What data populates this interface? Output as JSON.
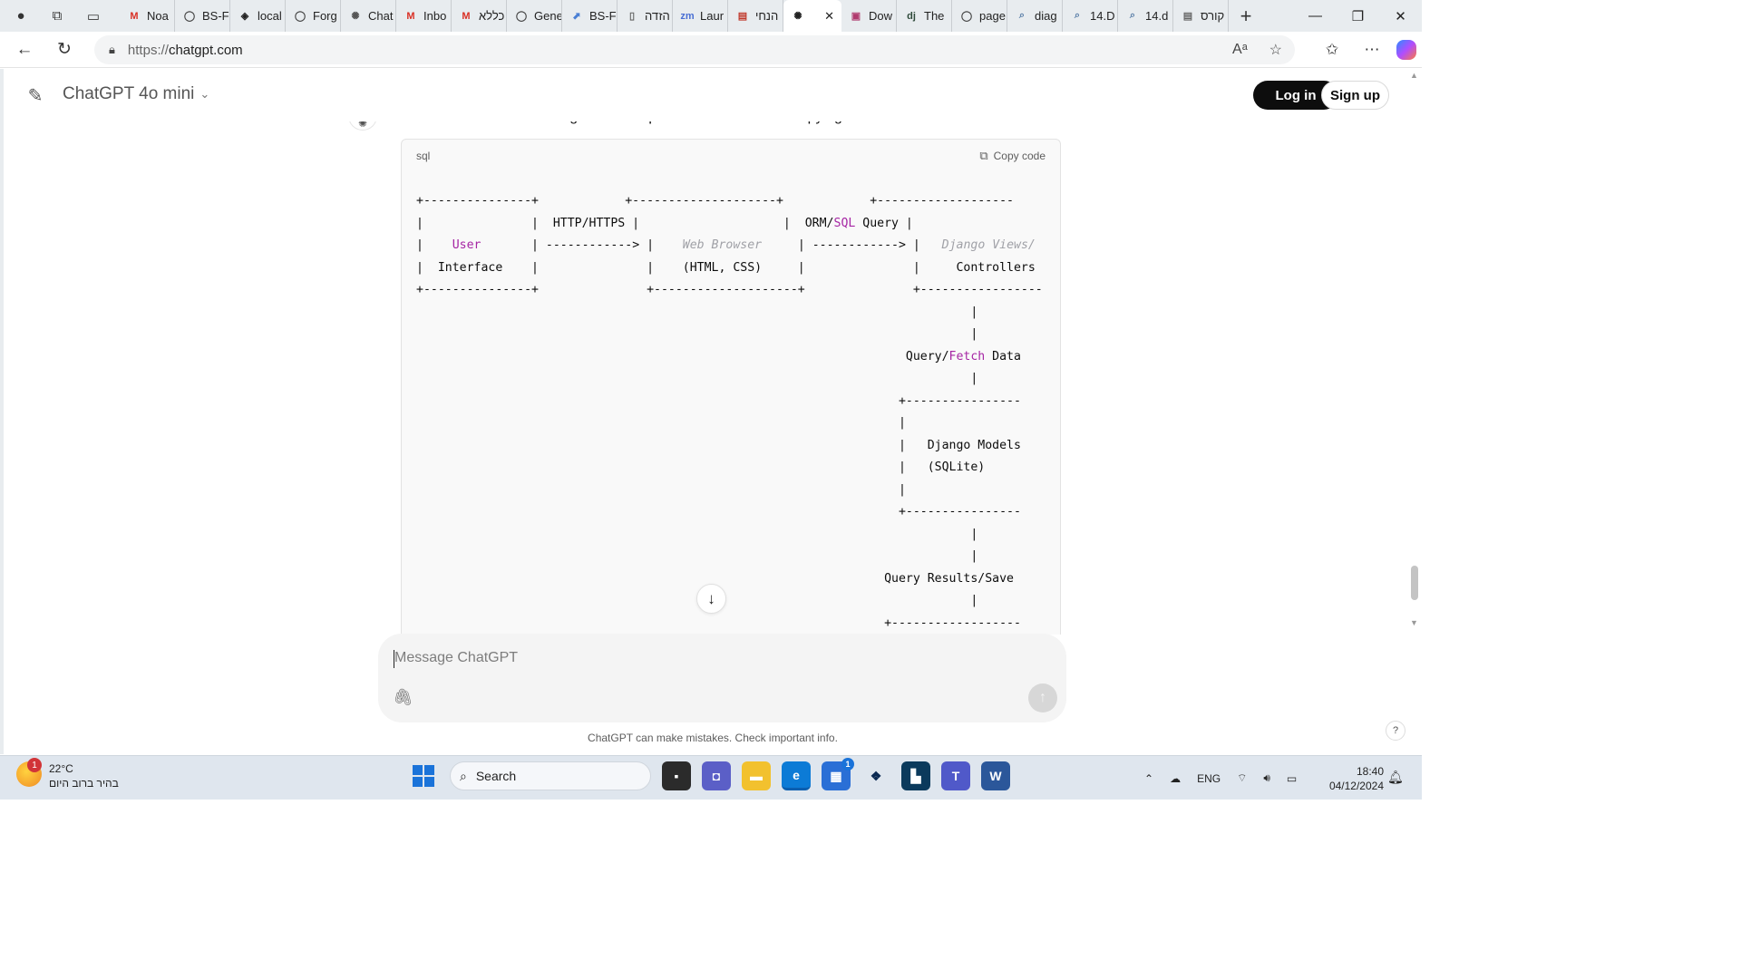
{
  "browser": {
    "tabs": [
      {
        "icon": "M",
        "icon_color": "#d93025",
        "label": "Noa"
      },
      {
        "icon": "◯",
        "icon_color": "#444444",
        "label": "BS-F"
      },
      {
        "icon": "◈",
        "icon_color": "#222222",
        "label": "local"
      },
      {
        "icon": "◯",
        "icon_color": "#444444",
        "label": "Forg"
      },
      {
        "icon": "✺",
        "icon_color": "#555555",
        "label": "Chat"
      },
      {
        "icon": "M",
        "icon_color": "#d93025",
        "label": "Inbo"
      },
      {
        "icon": "M",
        "icon_color": "#d93025",
        "label": "כללא"
      },
      {
        "icon": "◯",
        "icon_color": "#444444",
        "label": "Gene"
      },
      {
        "icon": "⬈",
        "icon_color": "#4a7fd4",
        "label": "BS-F"
      },
      {
        "icon": "▯",
        "icon_color": "#666666",
        "label": "הזדה"
      },
      {
        "icon": "zm",
        "icon_color": "#4a6fd4",
        "label": "Laur"
      },
      {
        "icon": "▤",
        "icon_color": "#c0392b",
        "label": "הנחי"
      }
    ],
    "active_tab": {
      "icon": "✺",
      "close": "✕"
    },
    "tabs_after": [
      {
        "icon": "▣",
        "icon_color": "#b03a6e",
        "label": "Dow"
      },
      {
        "icon": "dj",
        "icon_color": "#2e4a3a",
        "label": "The"
      },
      {
        "icon": "◯",
        "icon_color": "#444444",
        "label": "page"
      },
      {
        "icon": "⌕",
        "icon_color": "#5a7fa8",
        "label": "diag"
      },
      {
        "icon": "⌕",
        "icon_color": "#5a7fa8",
        "label": "14.D"
      },
      {
        "icon": "⌕",
        "icon_color": "#5a7fa8",
        "label": "14.d"
      },
      {
        "icon": "▤",
        "icon_color": "#666666",
        "label": "קורס"
      }
    ],
    "new_tab": "+",
    "url_proto": "https://",
    "url_host": "chatgpt.com",
    "window_controls": [
      "—",
      "❐",
      "✕"
    ]
  },
  "header": {
    "model": "ChatGPT 4o mini",
    "login": "Log in",
    "signup": "Sign up"
  },
  "message": {
    "text": "Here's the architecture diagram with square boxes for easier copying:"
  },
  "code": {
    "language": "sql",
    "copy_label": "Copy code",
    "lines": [
      "+---------------+            +--------------------+            +-------------------",
      "|               |  HTTP/HTTPS |                    |  ORM/SQL Query |",
      "|    User       | ------------> |    Web Browser     | ------------> |   Django Views/",
      "|  Interface    |               |    (HTML, CSS)     |               |     Controllers",
      "+---------------+               +--------------------+               +-----------------",
      "                                                                             |",
      "                                                                             |",
      "                                                                    Query/Fetch Data",
      "                                                                             |",
      "                                                                   +----------------",
      "                                                                   |",
      "                                                                   |   Django Models",
      "                                                                   |   (SQLite)",
      "                                                                   |",
      "                                                                   +----------------",
      "                                                                             |",
      "                                                                             |",
      "                                                                 Query Results/Save",
      "                                                                             |",
      "                                                                 +------------------"
    ]
  },
  "composer": {
    "placeholder": "Message ChatGPT"
  },
  "footer": {
    "disclaimer": "ChatGPT can make mistakes. Check important info.",
    "help": "?"
  },
  "taskbar": {
    "weather_temp": "22°C",
    "weather_desc": "בהיר ברוב היום",
    "weather_badge": "1",
    "search_label": "Search",
    "language": "ENG",
    "time": "18:40",
    "date": "04/12/2024",
    "store_badge": "1"
  }
}
